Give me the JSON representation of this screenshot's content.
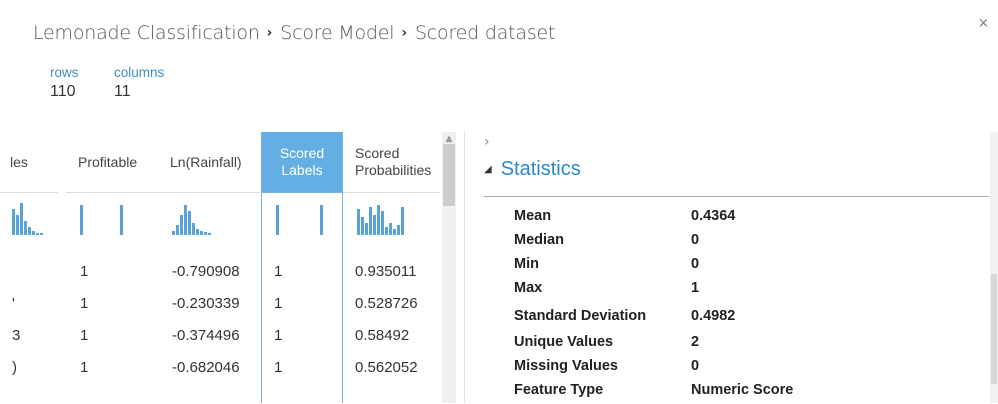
{
  "breadcrumb": {
    "items": [
      "Lemonade Classification",
      "Score Model",
      "Scored dataset"
    ],
    "separator": "›"
  },
  "close_glyph": "×",
  "counts": {
    "rows_label": "rows",
    "rows_value": "110",
    "columns_label": "columns",
    "columns_value": "11"
  },
  "table": {
    "columns": [
      {
        "header": "les",
        "cells": [
          "",
          "'",
          "3",
          ")"
        ],
        "spark": "histogram"
      },
      {
        "header": "Profitable",
        "cells": [
          "1",
          "1",
          "1",
          "1"
        ],
        "spark": "binary"
      },
      {
        "header": "Ln(Rainfall)",
        "cells": [
          "-0.790908",
          "-0.230339",
          "-0.374496",
          "-0.682046"
        ],
        "spark": "histogram"
      },
      {
        "header": "Scored Labels",
        "cells": [
          "1",
          "1",
          "1",
          "1"
        ],
        "spark": "binary",
        "selected": true
      },
      {
        "header": "Scored Probabilities",
        "cells": [
          "0.935011",
          "0.528726",
          "0.58492",
          "0.562052"
        ],
        "spark": "histogram"
      }
    ]
  },
  "panel": {
    "collapse_glyph": "›",
    "title": "Statistics",
    "stats": [
      {
        "key": "Mean",
        "value": "0.4364"
      },
      {
        "key": "Median",
        "value": "0"
      },
      {
        "key": "Min",
        "value": "0"
      },
      {
        "key": "Max",
        "value": "1"
      },
      {
        "key": "Standard Deviation",
        "value": "0.4982"
      },
      {
        "key": "Unique Values",
        "value": "2"
      },
      {
        "key": "Missing Values",
        "value": "0"
      },
      {
        "key": "Feature Type",
        "value": "Numeric Score"
      }
    ]
  },
  "colors": {
    "accent": "#63aee2",
    "label_blue": "#3d8fc6",
    "title_blue": "#2b88c9",
    "spark_blue": "#5ba3d6"
  }
}
